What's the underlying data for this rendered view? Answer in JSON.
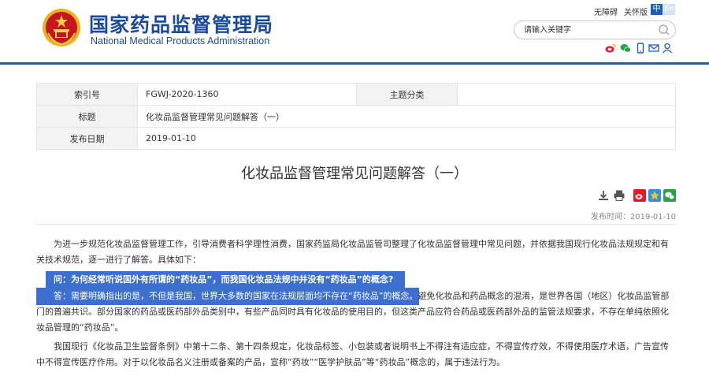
{
  "header": {
    "title_cn": "国家药品监督管理局",
    "title_en": "National Medical Products Administration",
    "accessibility_link": "无障碍",
    "care_mode_link": "关怀版",
    "lang_cn": "中",
    "lang_en": "En",
    "search_placeholder": "请输入关键字",
    "share_icons": [
      "weibo-icon",
      "wechat-icon",
      "mobile-icon",
      "mail-icon",
      "user-icon"
    ]
  },
  "meta": {
    "index_label": "索引号",
    "index_value": "FGWJ-2020-1360",
    "topic_label": "主题分类",
    "topic_value": "",
    "title_label": "标题",
    "title_value": "化妆品监督管理常见问题解答（一）",
    "date_label": "发布日期",
    "date_value": "2019-01-10"
  },
  "article": {
    "title": "化妆品监督管理常见问题解答（一）",
    "publish_time": "发布时间：2019-01-10",
    "intro": "为进一步规范化妆品监督管理工作，引导消费者科学理性消费，国家药监局化妆品监管司整理了化妆品监督管理中常见问题，并依据我国现行化妆品法规规定和有关技术规范，逐一进行了解答。具体如下：",
    "question": "问：为何经常听说国外有所谓的“药妆品”，而我国化妆品法规中并没有“药妆品”的概念?",
    "answer_highlight": "答：需要明确指出的是，不但是我国，世界大多数的国家在法规层面均不存在“药妆品”的概念。",
    "answer_rest": "避免化妆品和药品概念的混淆，是世界各国（地区）化妆品监管部门的普遍共识。部分国家的药品或医药部外品类别中，有些产品同时具有化妆品的使用目的，但这类产品应符合药品或医药部外品的监管法规要求，不存在单纯依照化妆品管理的“药妆品”。",
    "para3": "我国现行《化妆品卫生监督条例》中第十二条、第十四条规定，化妆品标签、小包装或者说明书上不得注有适应症，不得宣传疗效，不得使用医疗术语，广告宣传中不得宣传医疗作用。对于以化妆品名义注册或备案的产品，宣称“药妆”“医学护肤品”等“药妆品”概念的，属于违法行为。"
  },
  "tools": [
    "download-icon",
    "print-icon",
    "weibo-share-icon",
    "qzone-share-icon",
    "wechat-share-icon"
  ],
  "colors": {
    "brand_blue": "#1d5fb4",
    "highlight_blue": "#3c6fd0",
    "emblem_red": "#c8161d",
    "emblem_gold": "#e6b422"
  }
}
